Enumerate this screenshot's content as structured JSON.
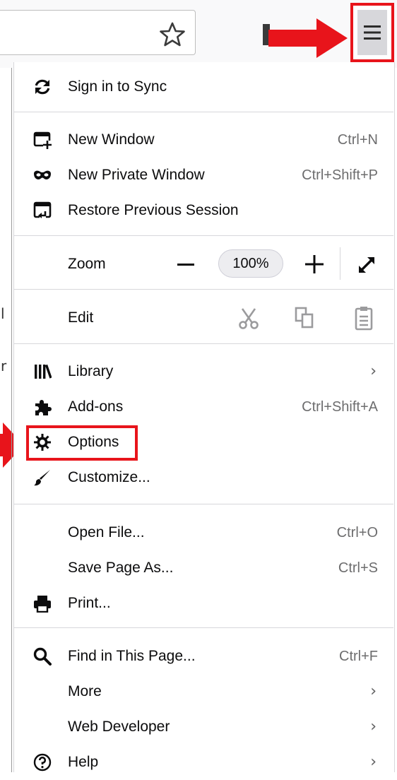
{
  "colors": {
    "highlight_red": "#e8141b",
    "panel_separator": "#d7d7db",
    "accel_text": "#6d6d6e"
  },
  "toolbar": {
    "bookmark_icon": "star-icon",
    "menu_button_icon": "hamburger-icon"
  },
  "menu": {
    "sync": {
      "label": "Sign in to Sync",
      "icon": "sync-icon"
    },
    "new_window": {
      "label": "New Window",
      "accel": "Ctrl+N",
      "icon": "new-window-icon"
    },
    "new_private_window": {
      "label": "New Private Window",
      "accel": "Ctrl+Shift+P",
      "icon": "private-mask-icon"
    },
    "restore_session": {
      "label": "Restore Previous Session",
      "icon": "restore-session-icon"
    },
    "zoom": {
      "label": "Zoom",
      "value": "100%",
      "minus": "−",
      "plus": "+",
      "fullscreen_icon": "fullscreen-icon"
    },
    "edit": {
      "label": "Edit",
      "cut_icon": "cut-icon",
      "copy_icon": "copy-icon",
      "paste_icon": "paste-icon"
    },
    "library": {
      "label": "Library",
      "chevron": "›",
      "icon": "library-icon"
    },
    "addons": {
      "label": "Add-ons",
      "accel": "Ctrl+Shift+A",
      "icon": "puzzle-icon"
    },
    "options": {
      "label": "Options",
      "icon": "gear-icon"
    },
    "customize": {
      "label": "Customize...",
      "icon": "brush-icon"
    },
    "open_file": {
      "label": "Open File...",
      "accel": "Ctrl+O"
    },
    "save_page": {
      "label": "Save Page As...",
      "accel": "Ctrl+S"
    },
    "print": {
      "label": "Print...",
      "icon": "printer-icon"
    },
    "find": {
      "label": "Find in This Page...",
      "accel": "Ctrl+F",
      "icon": "search-icon"
    },
    "more": {
      "label": "More",
      "chevron": "›"
    },
    "web_developer": {
      "label": "Web Developer",
      "chevron": "›"
    },
    "help": {
      "label": "Help",
      "chevron": "›",
      "icon": "help-icon"
    }
  },
  "page_edge_glyphs": [
    "l",
    "r"
  ]
}
